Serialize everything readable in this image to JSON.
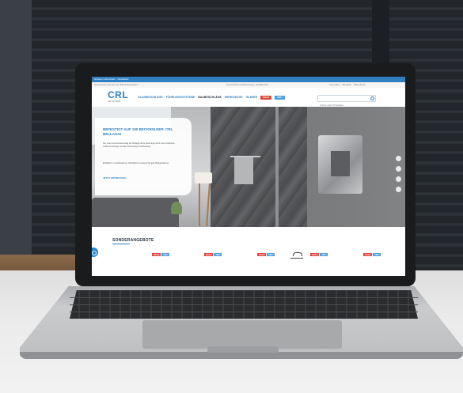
{
  "site": {
    "topbar_text": "Hinweis Lieferzeiten · Newsletter",
    "info_left": "Kostenloser Versand ab 500 € Bestellwert",
    "info_center": "Persönliche Fachberatung +49 800 000",
    "info_right": "Anmelden · Merkliste · Warenkorb",
    "logo": "CRL",
    "logo_sub": "CRL EUROPE",
    "nav": [
      "GLASBESCHLÄGE",
      "FÜHRUNGSSYSTEME",
      "BAUBESCHLÄGE",
      "WERKZEUGE",
      "GLÄSER"
    ],
    "nav_active_index": 2,
    "pill_sale": "SALE",
    "pill_new": "NEU",
    "search_placeholder": "Suche nach Produkten",
    "hero_title": "BEFESTIGT AUF 100 BECKENLEER. CRL BELLAGIO",
    "hero_body": "Der neue Duschtürbeschlag der Bellagio-Serie überzeugt durch sein schlankes, modernes Design und die hochwertige Verarbeitung.",
    "hero_body2": "Erhältlich in verschiedenen Oberflächen passend für jede Badgestaltung.",
    "hero_link": "JETZT ENTDECKEN ›",
    "offers_title": "SONDERANGEBOTE",
    "badge_sale": "SALE",
    "badge_new": "NEU",
    "accent_blue": "#2f7fc1",
    "sale_red": "#e2453a"
  }
}
